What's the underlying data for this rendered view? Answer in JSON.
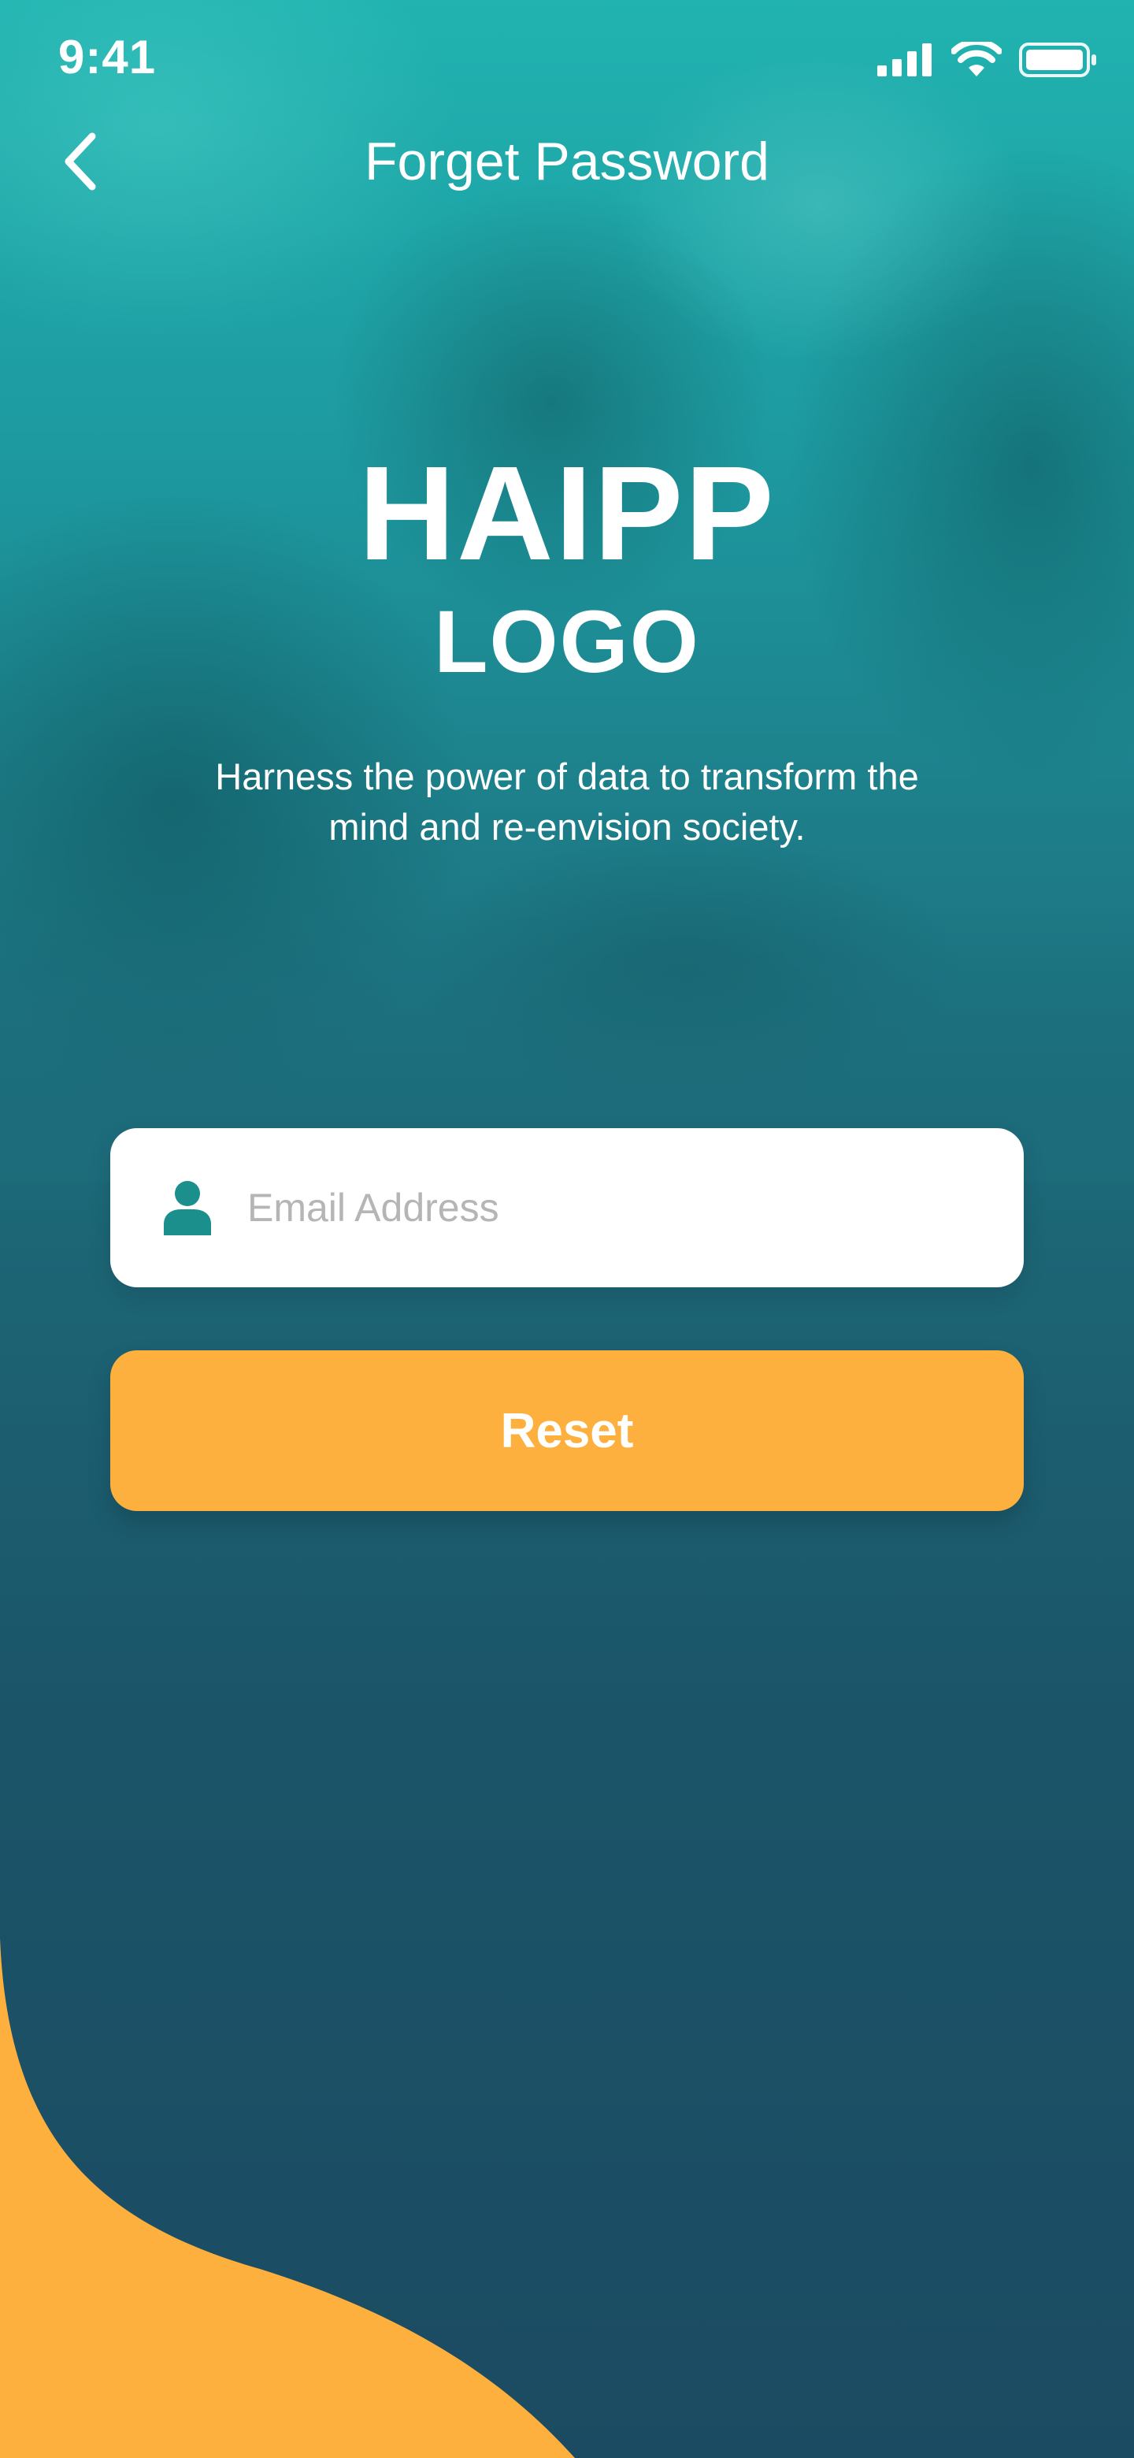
{
  "status_bar": {
    "time": "9:41",
    "icons": [
      "signal-icon",
      "wifi-icon",
      "battery-icon"
    ]
  },
  "nav": {
    "back_icon": "chevron-left-icon",
    "title": "Forget Password"
  },
  "logo": {
    "primary": "HAIPP",
    "secondary": "LOGO"
  },
  "tagline": "Harness the power of data to transform the mind and re-envision society.",
  "form": {
    "email": {
      "icon": "user-icon",
      "placeholder": "Email Address",
      "value": ""
    },
    "reset_label": "Reset"
  },
  "colors": {
    "accent": "#fdb03d",
    "teal_top": "#21b3b0",
    "navy_bottom": "#1b4b62",
    "icon_teal": "#1b8f8c",
    "placeholder": "#b5b5b5",
    "white": "#ffffff"
  }
}
